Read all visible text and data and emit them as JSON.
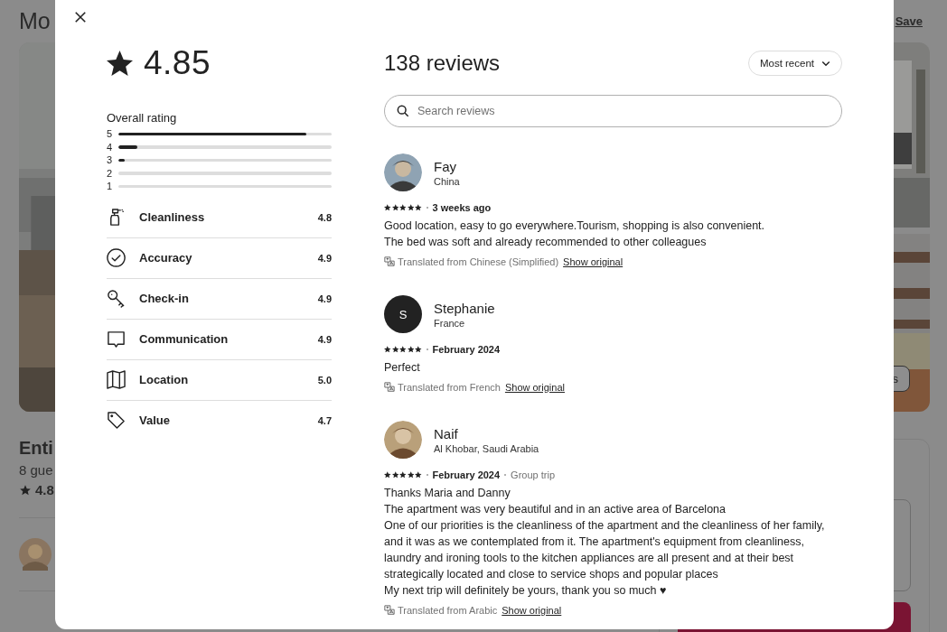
{
  "page_behind": {
    "title": "Mo",
    "save": "Save",
    "photos_button": "s",
    "listing_title": "Enti",
    "listing_details": "8 gue",
    "rating": "4.8"
  },
  "summary": {
    "rating": "4.85",
    "overall_label": "Overall rating",
    "distribution": [
      {
        "label": "5",
        "level": 0.88
      },
      {
        "label": "4",
        "level": 0.09
      },
      {
        "label": "3",
        "level": 0.03
      },
      {
        "label": "2"
      },
      {
        "label": "1"
      }
    ],
    "categories": [
      {
        "kind": "cleanliness",
        "label": "Cleanliness",
        "score": "4.8"
      },
      {
        "kind": "accuracy",
        "label": "Accuracy",
        "score": "4.9"
      },
      {
        "kind": "checkin",
        "label": "Check-in",
        "score": "4.9"
      },
      {
        "kind": "communication",
        "label": "Communication",
        "score": "4.9"
      },
      {
        "kind": "location",
        "label": "Location",
        "score": "5.0"
      },
      {
        "kind": "value",
        "label": "Value",
        "score": "4.7"
      }
    ]
  },
  "reviews_header": {
    "title": "138 reviews",
    "sort": "Most recent"
  },
  "search": {
    "placeholder": "Search reviews"
  },
  "reviews": [
    {
      "name": "Fay",
      "location": "China",
      "stars": 5,
      "date": "3 weeks ago",
      "text": "Good location, easy to go everywhere.Tourism, shopping is also convenient.\nThe bed was soft and already recommended to other colleagues",
      "translation": "Translated from Chinese (Simplified)",
      "show_original": "Show original"
    },
    {
      "name": "Stephanie",
      "location": "France",
      "avatar": {
        "kind": "initial",
        "initial": "S"
      },
      "stars": 5,
      "date": "February 2024",
      "text": "Perfect",
      "translation": "Translated from French",
      "show_original": "Show original"
    },
    {
      "name": "Naif",
      "location": "Al Khobar, Saudi Arabia",
      "stars": 5,
      "date": "February 2024",
      "trip": "Group trip",
      "text": "Thanks Maria and Danny\nThe apartment was very beautiful and in an active area of Barcelona\nOne of our priorities is the cleanliness of the apartment and the cleanliness of her family, and it was as we contemplated from it. The apartment's equipment from cleanliness, laundry and ironing tools to the kitchen appliances are all present and at their best strategically located and close to service shops and popular places\nMy next trip will definitely be yours, thank you so much ♥",
      "translation": "Translated from Arabic",
      "show_original": "Show original"
    }
  ]
}
